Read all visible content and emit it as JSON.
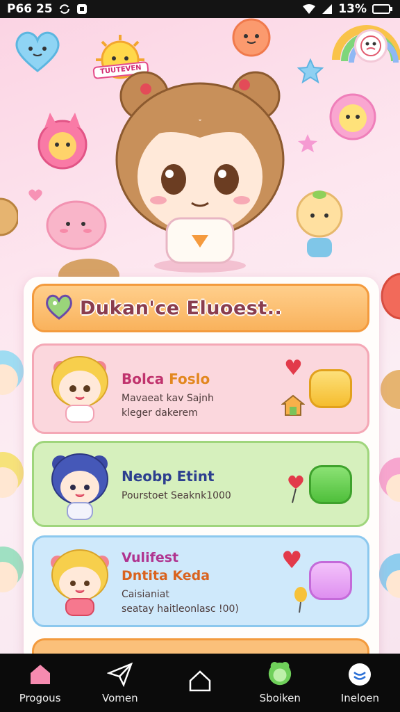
{
  "status_bar": {
    "time": "P66 25",
    "battery_text": "13%"
  },
  "header": {
    "sticker_text": "TUUTEVEN"
  },
  "panel": {
    "title": "Dukan'ce Eluoest.."
  },
  "cards": [
    {
      "name_part1": "Bolca",
      "name_part2": "Foslo",
      "line1": "Mavaeat kav Sajnh",
      "line2": "kleger dakerem"
    },
    {
      "name": "Neobp Etint",
      "line1": "Pourstoet Seaknk1000"
    },
    {
      "name_line1": "Vulifest",
      "name_line2": "Dntita Keda",
      "line1": "Caisianiat",
      "line2": "seatay haitleonlasc !00)"
    }
  ],
  "nav": [
    {
      "label": "Progous",
      "icon": "home-icon"
    },
    {
      "label": "Vomen",
      "icon": "paper-plane-icon"
    },
    {
      "label": "",
      "icon": "house-outline-icon"
    },
    {
      "label": "Sboiken",
      "icon": "character-icon"
    },
    {
      "label": "Ineloen",
      "icon": "profile-icon"
    }
  ],
  "colors": {
    "accent_orange": "#f9b25c",
    "pink_card": "#fbd7dd",
    "green_card": "#d6f0bd",
    "blue_card": "#cfe9fb",
    "yellow_button": "#f7c64a",
    "green_button": "#6fd05a",
    "purple_button": "#e8a7f3"
  }
}
